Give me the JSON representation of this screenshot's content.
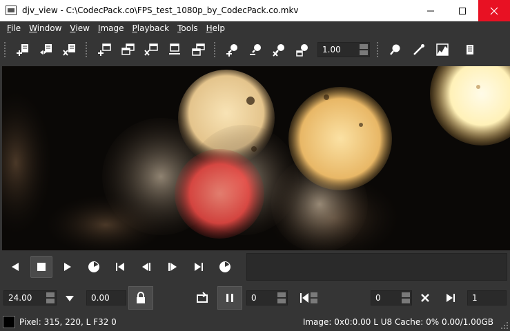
{
  "window": {
    "title": "djv_view - C:\\CodecPack.co\\FPS_test_1080p_by_CodecPack.co.mkv",
    "app_icon": "display-icon",
    "controls": {
      "minimize": "minimize-icon",
      "maximize": "maximize-icon",
      "close": "close-icon"
    },
    "close_color": "#e81123"
  },
  "menu": [
    {
      "key": "F",
      "rest": "ile"
    },
    {
      "key": "W",
      "rest": "indow"
    },
    {
      "key": "V",
      "rest": "iew"
    },
    {
      "key": "I",
      "rest": "mage"
    },
    {
      "key": "P",
      "rest": "layback"
    },
    {
      "key": "T",
      "rest": "ools"
    },
    {
      "key": "H",
      "rest": "elp"
    }
  ],
  "toolbar": {
    "file_buttons": [
      "file-open-icon",
      "file-reload-icon",
      "file-close-icon"
    ],
    "window_buttons": [
      "window-new-icon",
      "window-copy-icon",
      "window-close-icon",
      "window-fit-icon",
      "window-fullscreen-icon"
    ],
    "view_buttons": [
      "zoom-in-icon",
      "zoom-out-icon",
      "zoom-reset-icon",
      "view-fit-icon"
    ],
    "zoom_value": "1.00",
    "tool_buttons": [
      "magnify-icon",
      "color-picker-icon",
      "histogram-icon",
      "info-icon"
    ]
  },
  "playback": {
    "buttons": [
      "play-reverse-icon",
      "stop-icon",
      "play-forward-icon",
      "shuttle-icon",
      "frame-start-icon",
      "frame-previous-icon",
      "frame-next-icon",
      "frame-end-icon",
      "shuttle-frame-icon"
    ],
    "active_button": "stop-icon",
    "speed": "24.00",
    "speed_menu_icon": "chevron-down-icon",
    "real_speed": "0.00",
    "lock_icon": "lock-icon",
    "loop_icon": "loop-icon",
    "in_out_icon": "pause-in-out-icon",
    "current_frame": "0",
    "in_point": "0",
    "in_set_icon": "in-point-icon",
    "clear_icon": "clear-icon",
    "out_point_icon": "out-point-icon",
    "end_frame": "1"
  },
  "status": {
    "swatch_color": "#000000",
    "pixel": "Pixel: 315, 220, L F32 0",
    "info": "Image: 0x0:0.00 L U8  Cache: 0% 0.00/1.00GB"
  }
}
